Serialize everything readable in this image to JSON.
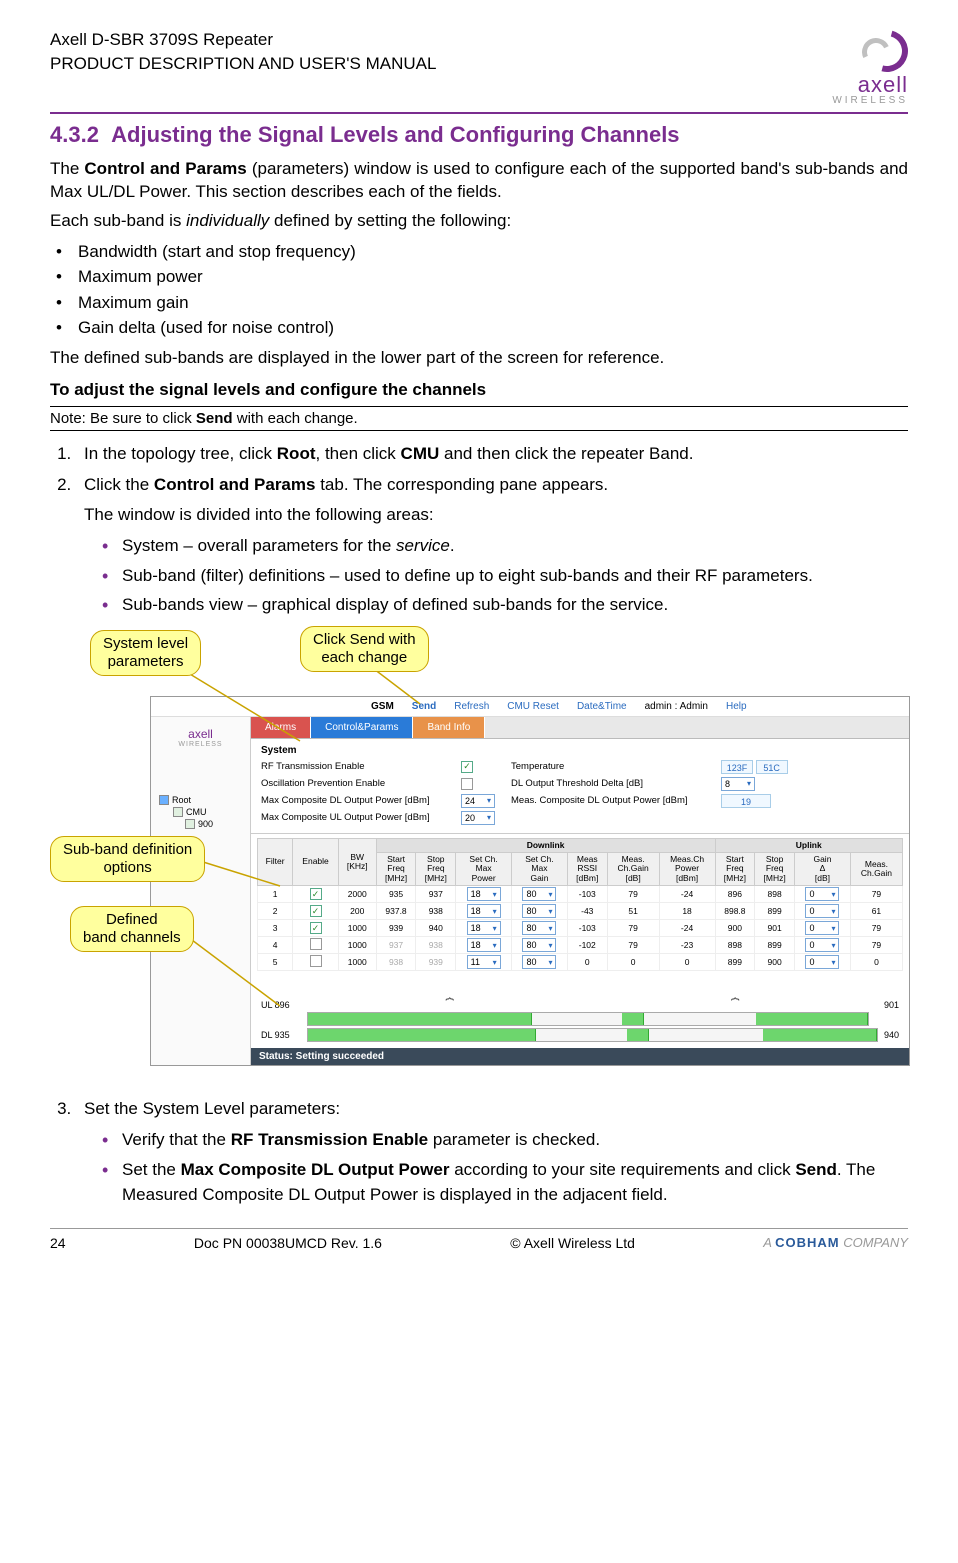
{
  "header": {
    "product": "Axell D-SBR 3709S Repeater",
    "subtitle": "PRODUCT DESCRIPTION AND USER'S MANUAL",
    "logo_main": "axell",
    "logo_sub": "WIRELESS"
  },
  "section": {
    "number": "4.3.2",
    "title": "Adjusting the Signal Levels and Configuring Channels"
  },
  "body": {
    "intro": "The Control and Params (parameters) window is used to configure each of the supported band's sub-bands and Max UL/DL Power. This section describes each of the fields.",
    "each_subband": "Each sub-band is individually defined by setting the following:",
    "bullets": [
      "Bandwidth (start and stop frequency)",
      "Maximum power",
      "Maximum gain",
      "Gain delta (used for noise control)"
    ],
    "defined_display": "The defined sub-bands are displayed in the lower part of the screen for reference.",
    "adjust_heading": "To adjust the signal levels and configure the channels",
    "note_prefix": "Note: Be sure to click ",
    "note_bold": "Send",
    "note_suffix": " with each change.",
    "step1_a": "In the topology tree, click ",
    "step1_b": "Root",
    "step1_c": ", then click ",
    "step1_d": "CMU",
    "step1_e": " and then click the repeater Band.",
    "step2_a": "Click the ",
    "step2_b": "Control and Params",
    "step2_c": " tab. The corresponding pane appears.",
    "step2_sub": "The window is divided into the following areas:",
    "step2_bullets": [
      "System – overall parameters for the service.",
      "Sub-band (filter) definitions – used to define up to eight sub-bands and their RF parameters.",
      "Sub-bands view – graphical display of defined sub-bands for the service."
    ],
    "step3": "Set the System Level parameters:",
    "step3_b1_a": "Verify that the ",
    "step3_b1_b": "RF Transmission Enable",
    "step3_b1_c": " parameter is checked.",
    "step3_b2_a": "Set the ",
    "step3_b2_b": "Max Composite DL Output Power",
    "step3_b2_c": " according to your site requirements and click ",
    "step3_b2_d": "Send",
    "step3_b2_e": ". The Measured Composite DL Output Power is displayed in the adjacent field."
  },
  "callouts": {
    "system": "System level\nparameters",
    "send": "Click Send with\neach change",
    "subband": "Sub-band definition\noptions",
    "defined": "Defined\nband channels"
  },
  "app": {
    "topbar": {
      "gsm": "GSM",
      "send": "Send",
      "refresh": "Refresh",
      "cmu_reset": "CMU Reset",
      "datetime": "Date&Time",
      "admin": "admin : Admin",
      "help": "Help"
    },
    "tabs": {
      "alarms": "Alarms",
      "control": "Control&Params",
      "band": "Band Info"
    },
    "tree": {
      "root": "Root",
      "cmu": "CMU",
      "band": "900"
    },
    "system": {
      "title": "System",
      "rf_enable": "RF Transmission Enable",
      "osc_prevent": "Oscillation Prevention Enable",
      "max_dl": "Max Composite DL Output Power [dBm]",
      "max_ul": "Max Composite UL Output Power [dBm]",
      "temperature": "Temperature",
      "dl_delta": "DL Output Threshold Delta [dB]",
      "meas_dl": "Meas. Composite DL Output Power [dBm]",
      "val_dl": "24",
      "val_ul": "20",
      "val_temp_f": "123F",
      "val_temp_c": "51C",
      "val_delta": "8",
      "val_meas": "19"
    },
    "filters": {
      "headers": {
        "filter": "Filter",
        "enable": "Enable",
        "bw": "BW\n[KHz]",
        "dl_group": "Downlink",
        "ul_group": "Uplink",
        "start": "Start\nFreq\n[MHz]",
        "stop": "Stop\nFreq\n[MHz]",
        "set_pwr": "Set Ch.\nMax\nPower",
        "set_gain": "Set Ch.\nMax\nGain",
        "meas_rssi": "Meas\nRSSI\n[dBm]",
        "meas_gain": "Meas.\nCh.Gain\n[dB]",
        "meas_pwr": "Meas.Ch\nPower\n[dBm]",
        "ul_start": "Start\nFreq\n[MHz]",
        "ul_stop": "Stop\nFreq\n[MHz]",
        "gain_d": "Gain\nΔ\n[dB]",
        "ul_meas": "Meas.\nCh.Gain"
      },
      "rows": [
        {
          "n": "1",
          "en": true,
          "bw": "2000",
          "dls": "935",
          "dle": "937",
          "pwr": "18",
          "gain": "80",
          "rssi": "-103",
          "mg": "79",
          "mp": "-24",
          "uls": "896",
          "ule": "898",
          "gd": "0",
          "umg": "79"
        },
        {
          "n": "2",
          "en": true,
          "bw": "200",
          "dls": "937.8",
          "dle": "938",
          "pwr": "18",
          "gain": "80",
          "rssi": "-43",
          "mg": "51",
          "mp": "18",
          "uls": "898.8",
          "ule": "899",
          "gd": "0",
          "umg": "61"
        },
        {
          "n": "3",
          "en": true,
          "bw": "1000",
          "dls": "939",
          "dle": "940",
          "pwr": "18",
          "gain": "80",
          "rssi": "-103",
          "mg": "79",
          "mp": "-24",
          "uls": "900",
          "ule": "901",
          "gd": "0",
          "umg": "79"
        },
        {
          "n": "4",
          "en": false,
          "bw": "1000",
          "dls": "937",
          "dle": "938",
          "pwr": "18",
          "gain": "80",
          "rssi": "-102",
          "mg": "79",
          "mp": "-23",
          "uls": "898",
          "ule": "899",
          "gd": "0",
          "umg": "79"
        },
        {
          "n": "5",
          "en": false,
          "bw": "1000",
          "dls": "938",
          "dle": "939",
          "pwr": "11",
          "gain": "80",
          "rssi": "0",
          "mg": "0",
          "mp": "0",
          "uls": "899",
          "ule": "900",
          "gd": "0",
          "umg": "0"
        }
      ]
    },
    "spectrum": {
      "ul_label": "UL 896",
      "ul_end": "901",
      "dl_label": "DL 935",
      "dl_end": "940"
    },
    "status": "Status: Setting succeeded"
  },
  "footer": {
    "page": "24",
    "doc": "Doc PN 00038UMCD Rev. 1.6",
    "copyright": "© Axell Wireless Ltd",
    "cobham_a": "A ",
    "cobham_b": "COBHAM",
    "cobham_c": " COMPANY"
  }
}
